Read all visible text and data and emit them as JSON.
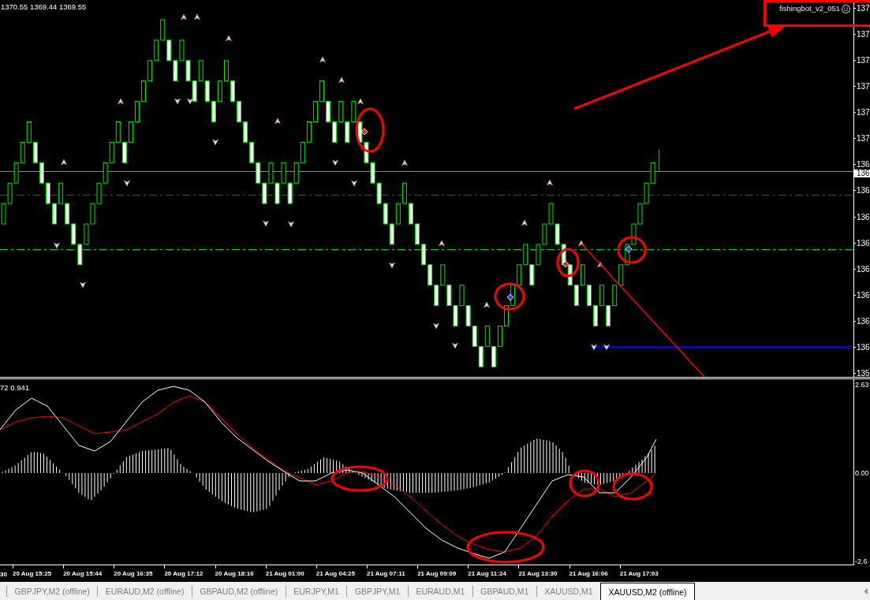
{
  "main_chart": {
    "ohlc_readout": "1370.55 1369.44 1369.55",
    "expert_label": "fishingbot_v2_051",
    "price_labels": [
      "137",
      "137",
      "137",
      "137",
      "137",
      "137",
      "136",
      "136",
      "136",
      "136",
      "136",
      "136",
      "136",
      "136",
      "135"
    ],
    "current_price_label": "136"
  },
  "indicator": {
    "readout": "72 0.941",
    "scale_labels": [
      "2.63",
      "0.00",
      "-2.6"
    ]
  },
  "time_axis": [
    "30",
    "20 Aug 15:25",
    "20 Aug 15:44",
    "20 Aug 16:35",
    "20 Aug 17:12",
    "20 Aug 18:16",
    "21 Aug 01:00",
    "21 Aug 04:25",
    "21 Aug 07:11",
    "21 Aug 09:09",
    "21 Aug 11:24",
    "21 Aug 13:30",
    "21 Aug 16:06",
    "21 Aug 17:03"
  ],
  "tabs": [
    {
      "label": "GBPJPY,M2 (offline)",
      "selected": false
    },
    {
      "label": "EURAUD,M2 (offline)",
      "selected": false
    },
    {
      "label": "GBPAUD,M2 (offline)",
      "selected": false
    },
    {
      "label": "EURJPY,M1",
      "selected": false
    },
    {
      "label": "GBPJPY,M1",
      "selected": false
    },
    {
      "label": "EURAUD,M1",
      "selected": false
    },
    {
      "label": "GBPAUD,M1",
      "selected": false
    },
    {
      "label": "XAUUSD,M1",
      "selected": false
    },
    {
      "label": "XAUUSD,M2 (offline)",
      "selected": true
    }
  ]
}
